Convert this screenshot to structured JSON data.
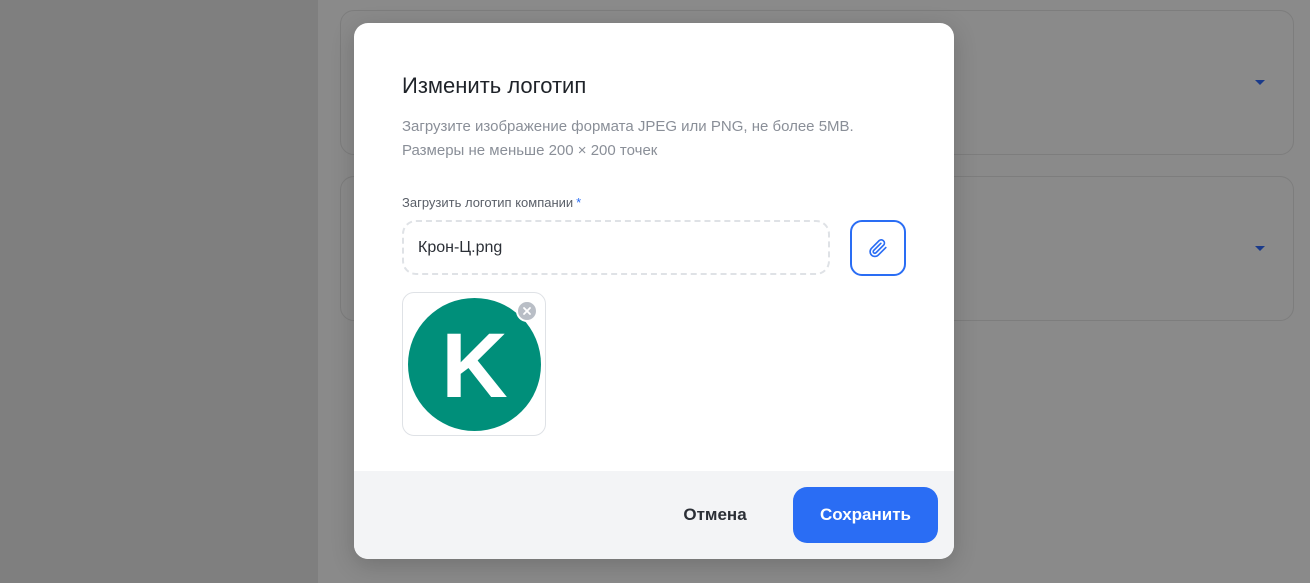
{
  "modal": {
    "title": "Изменить логотип",
    "description_line1": "Загрузите изображение формата JPEG или PNG, не более 5MB.",
    "description_line2": "Размеры не меньше 200 × 200 точек",
    "field_label": "Загрузить логотип компании",
    "required_mark": "*",
    "file_name": "Крон-Ц.png",
    "attach_icon": "paperclip-icon",
    "remove_icon": "close-icon",
    "preview": {
      "letter": "K",
      "circle_color": "#008f7a",
      "letter_color": "#ffffff"
    }
  },
  "footer": {
    "cancel_label": "Отмена",
    "save_label": "Сохранить"
  },
  "colors": {
    "accent": "#2a6df4",
    "overlay": "#7f7f7f",
    "footer_bg": "#f3f4f6",
    "title_text": "#1f2329",
    "muted_text": "#8a8f98"
  },
  "background": {
    "dropdown_icon": "caret-down-icon"
  }
}
